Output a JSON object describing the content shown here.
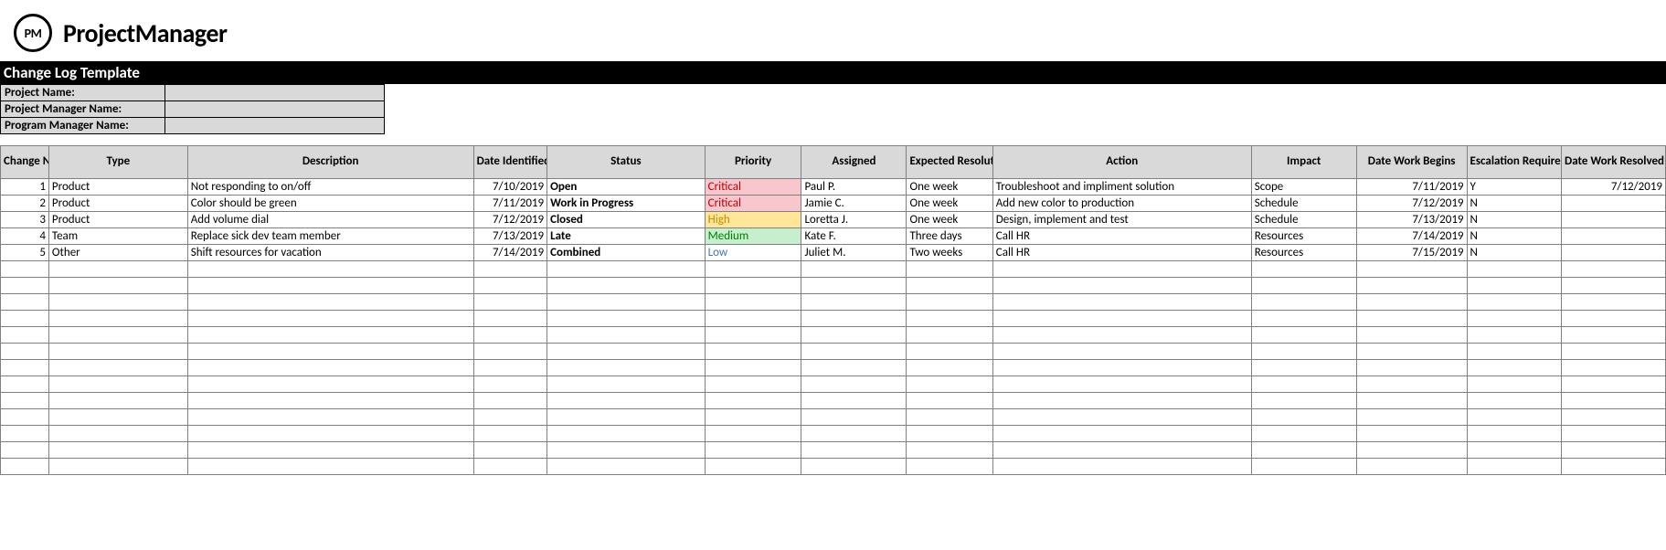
{
  "brand": {
    "logo_text": "PM",
    "name": "ProjectManager"
  },
  "title": "Change Log Template",
  "meta": {
    "project_label": "Project Name:",
    "project_value": "",
    "pm_label": "Project Manager Name:",
    "pm_value": "",
    "prog_label": "Program Manager Name:",
    "prog_value": ""
  },
  "headers": {
    "no": "Change No.",
    "type": "Type",
    "desc": "Description",
    "date_id": "Date Identified",
    "status": "Status",
    "priority": "Priority",
    "assigned": "Assigned",
    "exp_res": "Expected Resolution",
    "action": "Action",
    "impact": "Impact",
    "work_begins": "Date Work Begins",
    "escalation": "Escalation Required",
    "resolved": "Date Work Resolved"
  },
  "rows": [
    {
      "no": "1",
      "type": "Product",
      "desc": "Not responding to on/off",
      "date_id": "7/10/2019",
      "status": "Open",
      "priority": "Critical",
      "prio_class": "prio-critical",
      "assigned": "Paul P.",
      "exp_res": "One week",
      "action": "Troubleshoot and impliment solution",
      "impact": "Scope",
      "work_begins": "7/11/2019",
      "escalation": "Y",
      "resolved": "7/12/2019"
    },
    {
      "no": "2",
      "type": "Product",
      "desc": "Color should be green",
      "date_id": "7/11/2019",
      "status": "Work in Progress",
      "priority": "Critical",
      "prio_class": "prio-critical",
      "assigned": "Jamie C.",
      "exp_res": "One week",
      "action": "Add new color to production",
      "impact": "Schedule",
      "work_begins": "7/12/2019",
      "escalation": "N",
      "resolved": ""
    },
    {
      "no": "3",
      "type": "Product",
      "desc": "Add volume dial",
      "date_id": "7/12/2019",
      "status": "Closed",
      "priority": "High",
      "prio_class": "prio-high",
      "assigned": "Loretta J.",
      "exp_res": "One week",
      "action": "Design, implement and test",
      "impact": "Schedule",
      "work_begins": "7/13/2019",
      "escalation": "N",
      "resolved": ""
    },
    {
      "no": "4",
      "type": "Team",
      "desc": "Replace sick dev team member",
      "date_id": "7/13/2019",
      "status": "Late",
      "priority": "Medium",
      "prio_class": "prio-medium",
      "assigned": "Kate F.",
      "exp_res": "Three days",
      "action": "Call HR",
      "impact": "Resources",
      "work_begins": "7/14/2019",
      "escalation": "N",
      "resolved": ""
    },
    {
      "no": "5",
      "type": "Other",
      "desc": "Shift resources for vacation",
      "date_id": "7/14/2019",
      "status": "Combined",
      "priority": "Low",
      "prio_class": "prio-low",
      "assigned": "Juliet M.",
      "exp_res": "Two weeks",
      "action": "Call HR",
      "impact": "Resources",
      "work_begins": "7/15/2019",
      "escalation": "N",
      "resolved": ""
    }
  ],
  "empty_rows": 13
}
